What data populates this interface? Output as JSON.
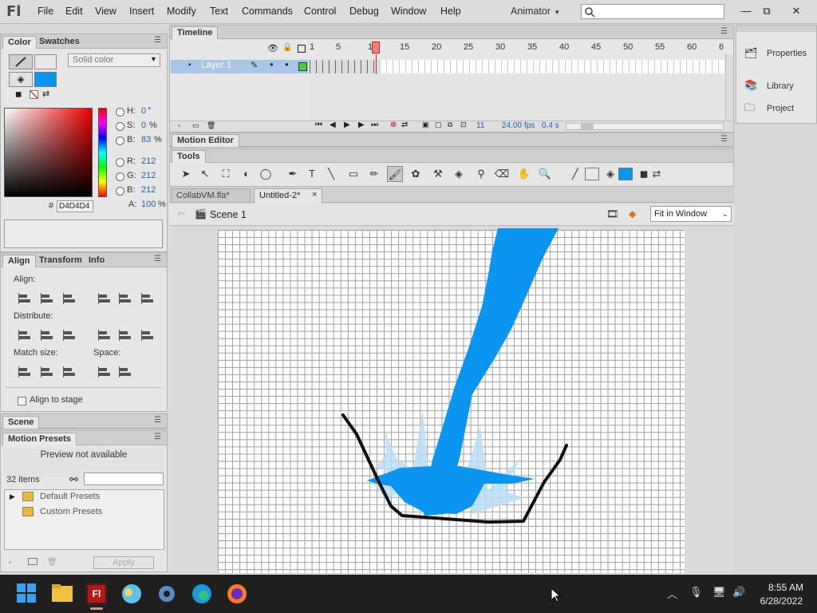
{
  "app": {
    "logo": "Fl",
    "workspace": "Animator",
    "workspace_caret": "▾"
  },
  "menu": [
    "File",
    "Edit",
    "View",
    "Insert",
    "Modify",
    "Text",
    "Commands",
    "Control",
    "Debug",
    "Window",
    "Help"
  ],
  "window_controls": {
    "minimize": "—",
    "restore": "⧉",
    "close": "✕"
  },
  "color_panel": {
    "tabs": [
      "Color",
      "Swatches"
    ],
    "fill_type": "Solid color",
    "hsb": [
      {
        "k": "H:",
        "v": "0",
        "u": "°"
      },
      {
        "k": "S:",
        "v": "0",
        "u": "%"
      },
      {
        "k": "B:",
        "v": "83",
        "u": "%"
      }
    ],
    "rgb": [
      {
        "k": "R:",
        "v": "212"
      },
      {
        "k": "G:",
        "v": "212"
      },
      {
        "k": "B:",
        "v": "212"
      }
    ],
    "hex_label": "#",
    "hex": "D4D4D4",
    "alpha_label": "A:",
    "alpha": "100",
    "alpha_unit": "%",
    "fill_color": "#0a96f0"
  },
  "align_panel": {
    "tabs": [
      "Align",
      "Transform",
      "Info"
    ],
    "align_label": "Align:",
    "distribute_label": "Distribute:",
    "match_label": "Match size:",
    "space_label": "Space:",
    "align_to_stage": "Align to stage"
  },
  "scene_panel": {
    "title": "Scene"
  },
  "motion_presets": {
    "title": "Motion Presets",
    "preview": "Preview not available",
    "count": "32 items",
    "folders": [
      "Default Presets",
      "Custom Presets"
    ],
    "apply": "Apply"
  },
  "timeline": {
    "title": "Timeline",
    "ruler": [
      "1",
      "5",
      "10",
      "15",
      "20",
      "25",
      "30",
      "35",
      "40",
      "45",
      "50",
      "55",
      "60",
      "6"
    ],
    "layer": "Layer 1",
    "current_frame": "11",
    "fps": "24.00",
    "fps_unit": "fps",
    "time": "0.4 s"
  },
  "motion_editor": {
    "title": "Motion Editor"
  },
  "tools": {
    "title": "Tools"
  },
  "doc_tabs": [
    "CollabVM.fla*",
    "Untitled-2*"
  ],
  "doc_tab_close": "×",
  "scene": {
    "name": "Scene 1",
    "zoom": "Fit in Window"
  },
  "right_panel": [
    "Properties",
    "Library",
    "Project"
  ],
  "taskbar": {
    "time": "8:55 AM",
    "date": "6/28/2022"
  }
}
